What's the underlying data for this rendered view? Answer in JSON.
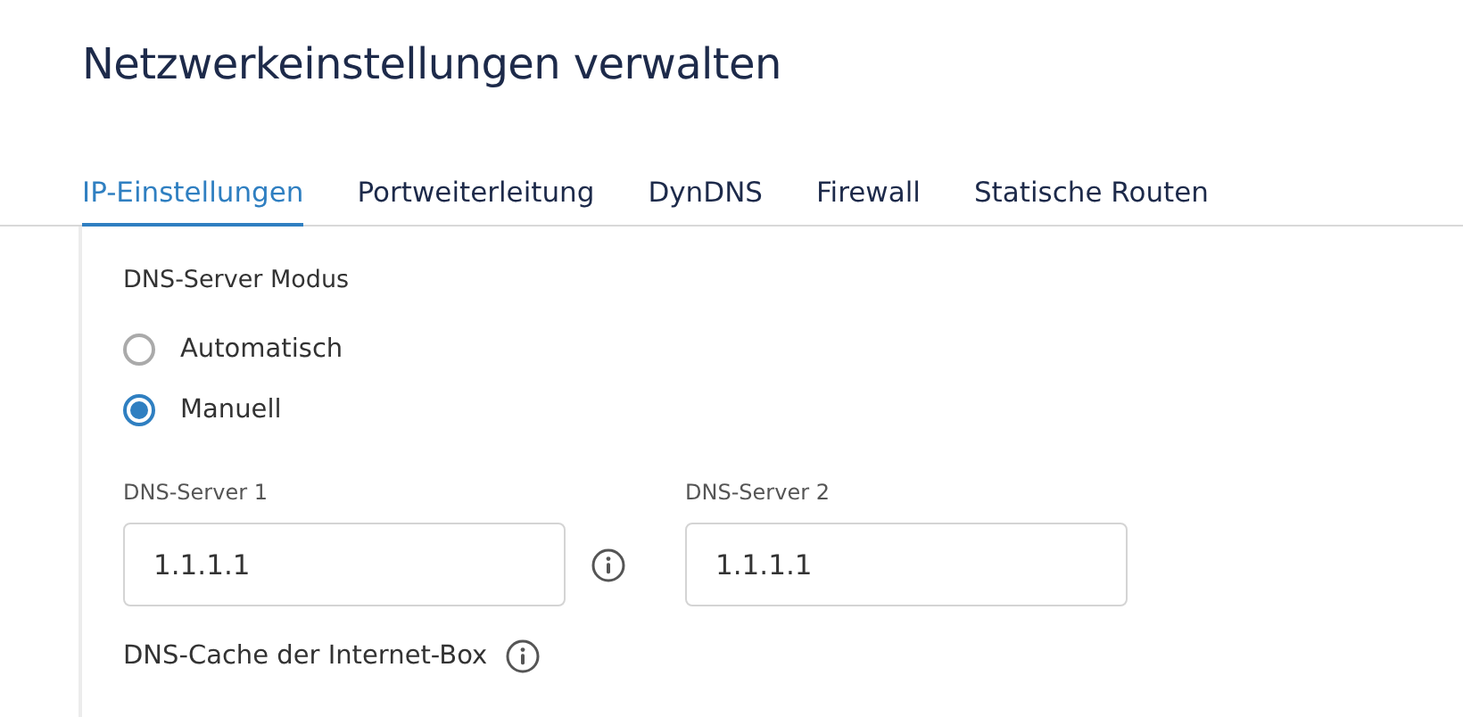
{
  "title": "Netzwerkeinstellungen verwalten",
  "tabs": [
    {
      "label": "IP-Einstellungen",
      "selected": true
    },
    {
      "label": "Portweiterleitung",
      "selected": false
    },
    {
      "label": "DynDNS",
      "selected": false
    },
    {
      "label": "Firewall",
      "selected": false
    },
    {
      "label": "Statische Routen",
      "selected": false
    }
  ],
  "dns_mode": {
    "label": "DNS-Server Modus",
    "options": [
      {
        "label": "Automatisch",
        "selected": false
      },
      {
        "label": "Manuell",
        "selected": true
      }
    ]
  },
  "dns_servers": [
    {
      "label": "DNS-Server 1",
      "value": "1.1.1.1",
      "info": true
    },
    {
      "label": "DNS-Server 2",
      "value": "1.1.1.1",
      "info": false
    }
  ],
  "dns_cache": {
    "label": "DNS-Cache der Internet-Box"
  }
}
